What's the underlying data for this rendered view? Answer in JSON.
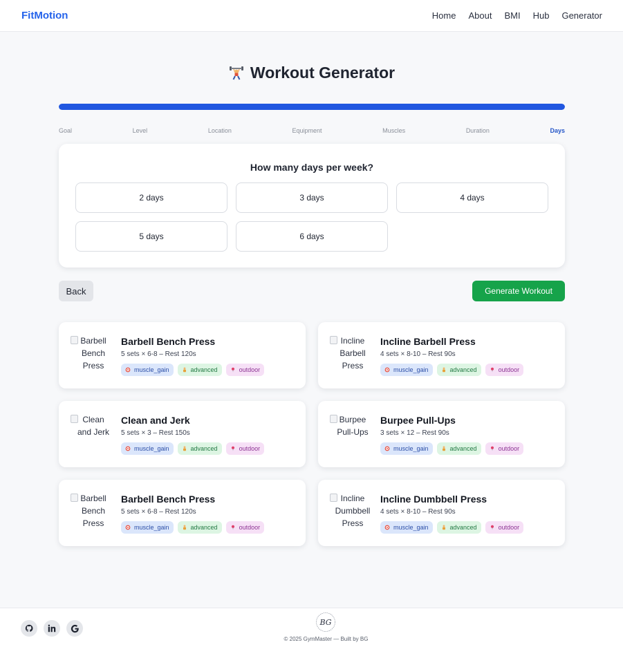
{
  "header": {
    "brand": "FitMotion",
    "nav": [
      "Home",
      "About",
      "BMI",
      "Hub",
      "Generator"
    ]
  },
  "page": {
    "title": "Workout Generator",
    "icon": "weightlifter-icon"
  },
  "progress": {
    "fraction": 1.0,
    "steps": [
      "Goal",
      "Level",
      "Location",
      "Equipment",
      "Muscles",
      "Duration",
      "Days"
    ],
    "active_step": "Days"
  },
  "question": {
    "title": "How many days per week?",
    "options": [
      "2 days",
      "3 days",
      "4 days",
      "5 days",
      "6 days"
    ]
  },
  "actions": {
    "back": "Back",
    "generate": "Generate Workout"
  },
  "workouts": [
    {
      "alt_lines": [
        "Barbell",
        "Bench",
        "Press"
      ],
      "name": "Barbell Bench Press",
      "meta": "5 sets × 6-8 – Rest 120s",
      "tags": [
        "muscle_gain",
        "advanced",
        "outdoor"
      ]
    },
    {
      "alt_lines": [
        "Incline",
        "Barbell",
        "Press"
      ],
      "name": "Incline Barbell Press",
      "meta": "4 sets × 8-10 – Rest 90s",
      "tags": [
        "muscle_gain",
        "advanced",
        "outdoor"
      ]
    },
    {
      "alt_lines": [
        "Clean",
        "and Jerk"
      ],
      "name": "Clean and Jerk",
      "meta": "5 sets × 3 – Rest 150s",
      "tags": [
        "muscle_gain",
        "advanced",
        "outdoor"
      ]
    },
    {
      "alt_lines": [
        "Burpee",
        "Pull-Ups"
      ],
      "name": "Burpee Pull-Ups",
      "meta": "3 sets × 12 – Rest 90s",
      "tags": [
        "muscle_gain",
        "advanced",
        "outdoor"
      ]
    },
    {
      "alt_lines": [
        "Barbell",
        "Bench",
        "Press"
      ],
      "name": "Barbell Bench Press",
      "meta": "5 sets × 6-8 – Rest 120s",
      "tags": [
        "muscle_gain",
        "advanced",
        "outdoor"
      ]
    },
    {
      "alt_lines": [
        "Incline",
        "Dumbbell",
        "Press"
      ],
      "name": "Incline Dumbbell Press",
      "meta": "4 sets × 8-10 – Rest 90s",
      "tags": [
        "muscle_gain",
        "advanced",
        "outdoor"
      ]
    }
  ],
  "tag_icons": [
    "target-icon",
    "person-icon",
    "pin-icon"
  ],
  "footer": {
    "copyright": "© 2025 GymMaster — Built by BG",
    "logo_text": "BG",
    "social": [
      {
        "icon": "github-icon",
        "glyph": "⌂"
      },
      {
        "icon": "linkedin-icon",
        "glyph": "in"
      },
      {
        "icon": "google-icon",
        "glyph": "G"
      }
    ]
  },
  "colors": {
    "brand": "#2563eb",
    "progress": "#2157e0",
    "generate": "#16a34a",
    "active_step": "#2456c7"
  }
}
